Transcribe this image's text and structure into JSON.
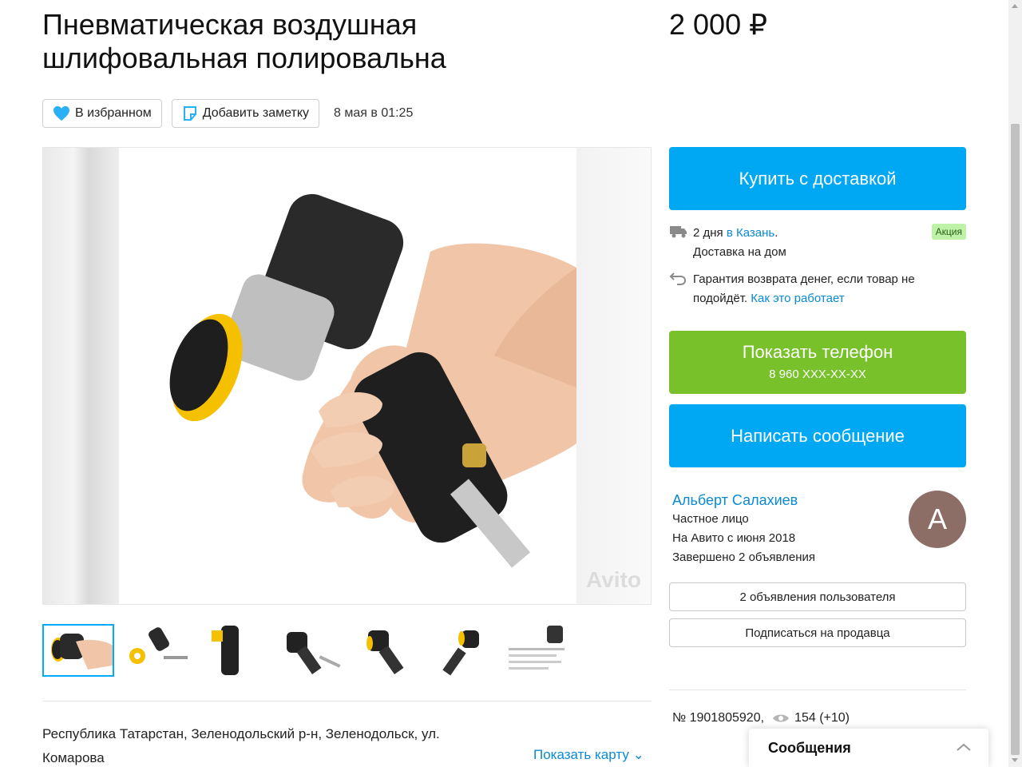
{
  "listing": {
    "title": "Пневматическая воздушная шлифовальная полировальна",
    "price": "2 000 ₽",
    "favorite_label": "В избранном",
    "note_label": "Добавить заметку",
    "date": "8 мая в 01:25",
    "watermark": "Avito"
  },
  "gallery": {
    "thumbnail_count": 7,
    "active_index": 0
  },
  "address": {
    "text": "Республика Татарстан, Зеленодольский р-н, Зеленодольск, ул. Комарова",
    "show_map": "Показать карту"
  },
  "buy": {
    "button": "Купить с доставкой",
    "delivery_days": "2 дня",
    "delivery_city": "в Казань",
    "delivery_dot": ".",
    "delivery_type": "Доставка на дом",
    "badge": "Акция",
    "guarantee_text": "Гарантия возврата денег, если товар не подойдёт.",
    "guarantee_link": "Как это работает"
  },
  "contact": {
    "phone_label": "Показать телефон",
    "phone_number": "8 960 XXX-XX-XX",
    "message_label": "Написать сообщение"
  },
  "seller": {
    "name": "Альберт Салахиев",
    "type": "Частное лицо",
    "since": "На Авито с июня 2018",
    "completed": "Завершено 2 объявления",
    "avatar_letter": "А",
    "avatar_color": "#8c6e66",
    "ads_button": "2 объявления пользователя",
    "subscribe_button": "Подписаться на продавца"
  },
  "stats": {
    "number": "№ 1901805920,",
    "views": "154 (+10)"
  },
  "messages_bar": {
    "label": "Сообщения"
  },
  "colors": {
    "accent_blue": "#00a8f4",
    "phone_green": "#78c12b",
    "link_blue": "#0a8ad6"
  }
}
